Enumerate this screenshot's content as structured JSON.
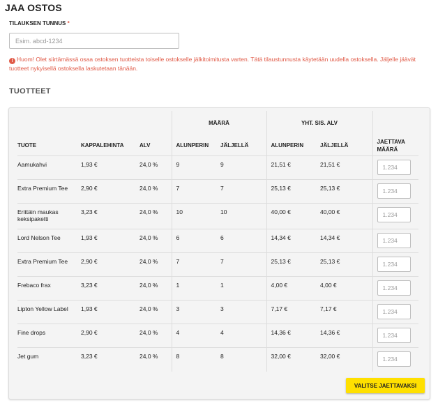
{
  "title": "JAA OSTOS",
  "order_field": {
    "label": "TILAUKSEN TUNNUS",
    "required_mark": "*",
    "placeholder": "Esim. abcd-1234"
  },
  "warning": {
    "icon": "exclamation-icon",
    "text": "Huom! Olet siirtämässä osaa ostoksen tuotteista toiselle ostokselle jälkitoimitusta varten. Tätä tilaustunnusta käytetään uudella ostoksella. Jäljelle jäävät tuotteet nykyisellä ostoksella laskutetaan tänään."
  },
  "section_title": "TUOTTEET",
  "table": {
    "group_headers": {
      "maara": "MÄÄRÄ",
      "yht": "YHT. SIS. ALV"
    },
    "headers": {
      "tuote": "TUOTE",
      "kappalehinta": "KAPPALEHINTA",
      "alv": "ALV",
      "alunperin": "ALUNPERIN",
      "jaljella": "JÄLJELLÄ",
      "yht_alunperin": "ALUNPERIN",
      "yht_jaljella": "JÄLJELLÄ",
      "jaettava_1": "JAETTAVA",
      "jaettava_2": "MÄÄRÄ"
    },
    "qty_placeholder": "1.234",
    "rows": [
      {
        "tuote": "Aamukahvi",
        "hinta": "1,93 €",
        "alv": "24,0 %",
        "alunperin": "9",
        "jaljella": "9",
        "yht_alunperin": "21,51 €",
        "yht_jaljella": "21,51 €"
      },
      {
        "tuote": "Extra Premium Tee",
        "hinta": "2,90 €",
        "alv": "24,0 %",
        "alunperin": "7",
        "jaljella": "7",
        "yht_alunperin": "25,13 €",
        "yht_jaljella": "25,13 €"
      },
      {
        "tuote": "Erittäin maukas keksipaketti",
        "hinta": "3,23 €",
        "alv": "24,0 %",
        "alunperin": "10",
        "jaljella": "10",
        "yht_alunperin": "40,00 €",
        "yht_jaljella": "40,00 €"
      },
      {
        "tuote": "Lord Nelson Tee",
        "hinta": "1,93 €",
        "alv": "24,0 %",
        "alunperin": "6",
        "jaljella": "6",
        "yht_alunperin": "14,34 €",
        "yht_jaljella": "14,34 €"
      },
      {
        "tuote": "Extra Premium Tee",
        "hinta": "2,90 €",
        "alv": "24,0 %",
        "alunperin": "7",
        "jaljella": "7",
        "yht_alunperin": "25,13 €",
        "yht_jaljella": "25,13 €"
      },
      {
        "tuote": "Frebaco frax",
        "hinta": "3,23 €",
        "alv": "24,0 %",
        "alunperin": "1",
        "jaljella": "1",
        "yht_alunperin": "4,00 €",
        "yht_jaljella": "4,00 €"
      },
      {
        "tuote": "Lipton Yellow Label",
        "hinta": "1,93 €",
        "alv": "24,0 %",
        "alunperin": "3",
        "jaljella": "3",
        "yht_alunperin": "7,17 €",
        "yht_jaljella": "7,17 €"
      },
      {
        "tuote": "Fine drops",
        "hinta": "2,90 €",
        "alv": "24,0 %",
        "alunperin": "4",
        "jaljella": "4",
        "yht_alunperin": "14,36 €",
        "yht_jaljella": "14,36 €"
      },
      {
        "tuote": "Jet gum",
        "hinta": "3,23 €",
        "alv": "24,0 %",
        "alunperin": "8",
        "jaljella": "8",
        "yht_alunperin": "32,00 €",
        "yht_jaljella": "32,00 €"
      }
    ]
  },
  "submit_label": "VALITSE JAETTAVAKSI",
  "colors": {
    "accent": "#ffe000",
    "warning": "#e05a47",
    "card_bg": "#f4f4f4"
  }
}
